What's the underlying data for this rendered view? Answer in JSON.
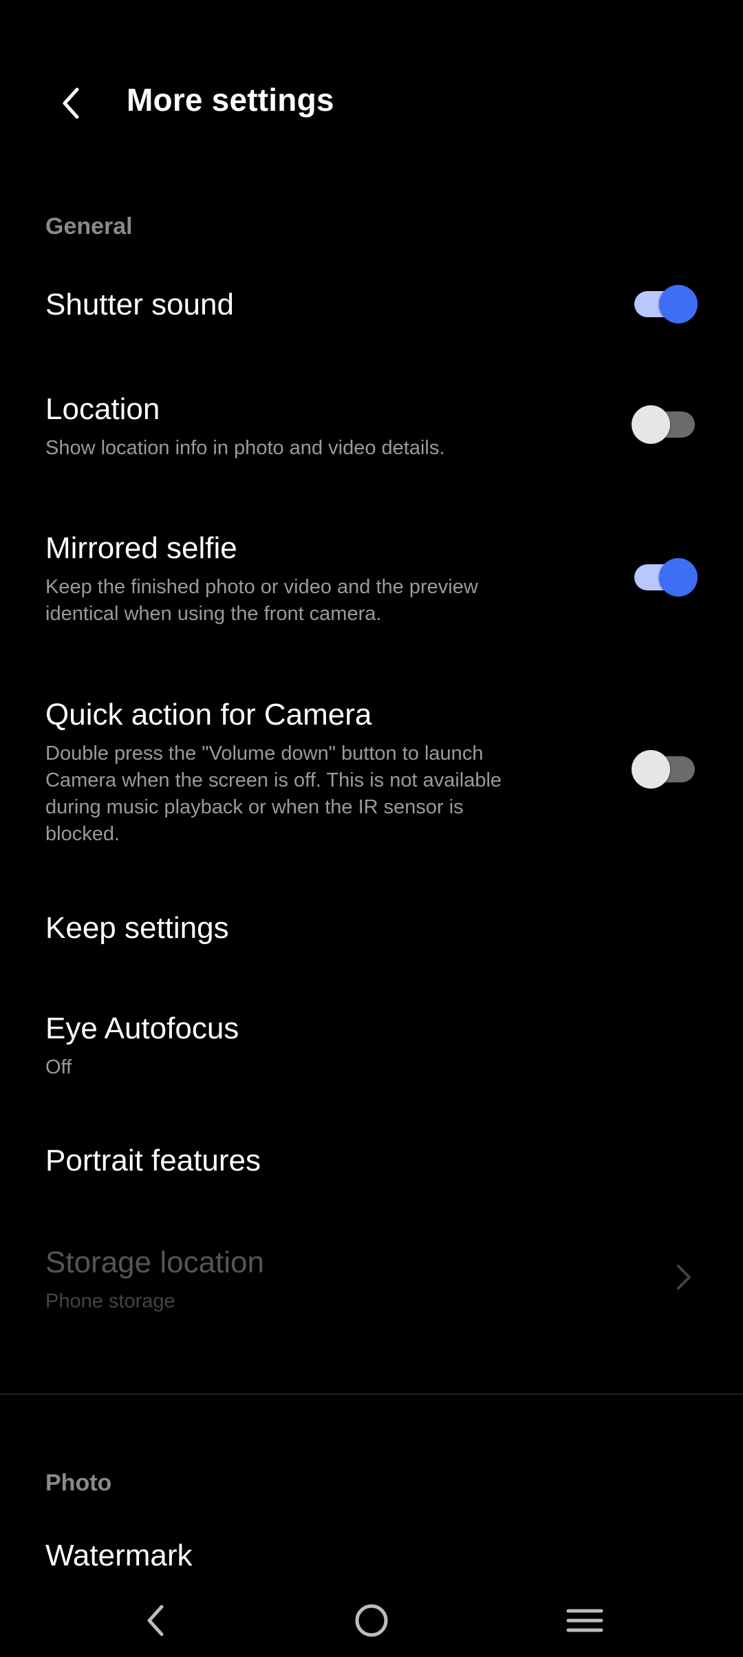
{
  "header": {
    "title": "More settings",
    "back_icon": "chevron-left-icon"
  },
  "sections": {
    "general": "General",
    "photo": "Photo"
  },
  "rows": {
    "shutter_sound": {
      "title": "Shutter sound",
      "toggle_on": true
    },
    "location": {
      "title": "Location",
      "subtitle": "Show location info in photo and video details.",
      "toggle_on": false
    },
    "mirrored_selfie": {
      "title": "Mirrored selfie",
      "subtitle": "Keep the finished photo or video and the preview identical when using the front camera.",
      "toggle_on": true
    },
    "quick_action": {
      "title": "Quick action for Camera",
      "subtitle": "Double press the \"Volume down\" button to launch Camera when the screen is off. This is not available during music playback or when the IR sensor is blocked.",
      "toggle_on": false
    },
    "keep_settings": {
      "title": "Keep settings"
    },
    "eye_autofocus": {
      "title": "Eye Autofocus",
      "subtitle": "Off"
    },
    "portrait_features": {
      "title": "Portrait features"
    },
    "storage_location": {
      "title": "Storage location",
      "subtitle": "Phone storage",
      "enabled": false
    },
    "watermark": {
      "title": "Watermark"
    }
  },
  "colors": {
    "background": "#000000",
    "accent": "#3d6ef5",
    "accent_track": "#b9c7ff",
    "section_header": "#8a8a8a",
    "subtitle": "#9a9a9a",
    "disabled": "#555555"
  },
  "navbar": {
    "back_icon": "triangle-back-icon",
    "home_icon": "circle-home-icon",
    "menu_icon": "hamburger-menu-icon"
  }
}
